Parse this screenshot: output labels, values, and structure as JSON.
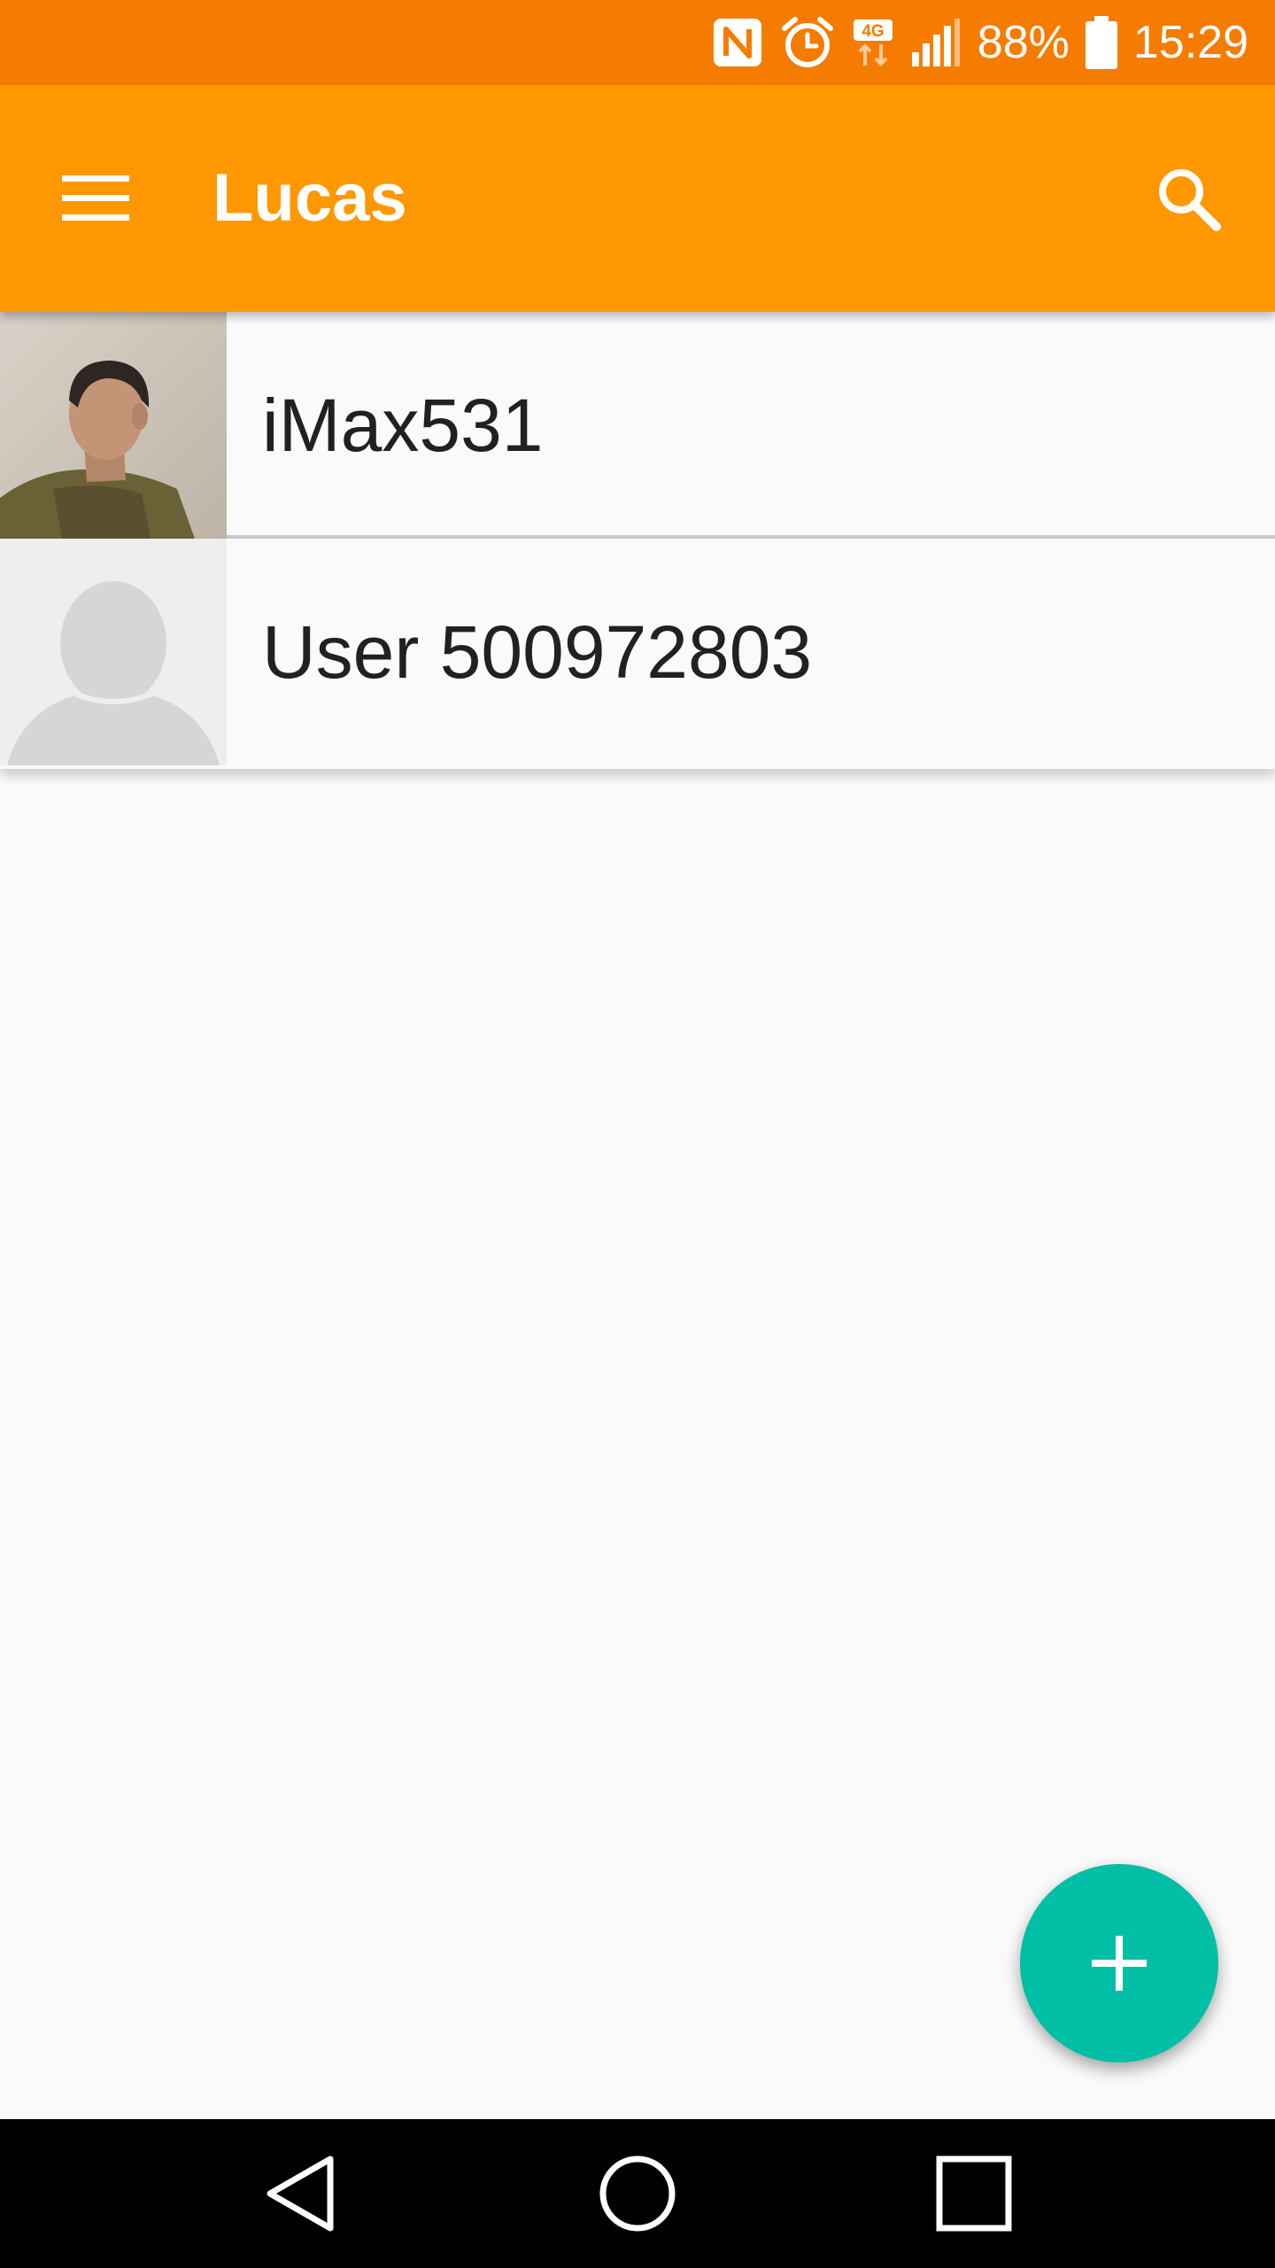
{
  "status_bar": {
    "battery_percent": "88%",
    "time": "15:29",
    "network_label": "4G",
    "icons": [
      "nfc-icon",
      "alarm-icon",
      "network-4g-icon",
      "signal-icon",
      "battery-icon"
    ]
  },
  "app_bar": {
    "title": "Lucas",
    "menu_icon": "menu-icon",
    "search_icon": "search-icon"
  },
  "contacts": [
    {
      "name": "iMax531",
      "avatar": "photo"
    },
    {
      "name": "User 500972803",
      "avatar": "default-person"
    }
  ],
  "fab": {
    "icon": "add-icon"
  },
  "nav_bar": {
    "buttons": [
      "back-icon",
      "home-icon",
      "recents-icon"
    ]
  },
  "colors": {
    "status_bar": "#f57c00",
    "app_bar": "#ff9800",
    "fab": "#00bfa5",
    "background": "#fafafa",
    "text": "#212121"
  }
}
